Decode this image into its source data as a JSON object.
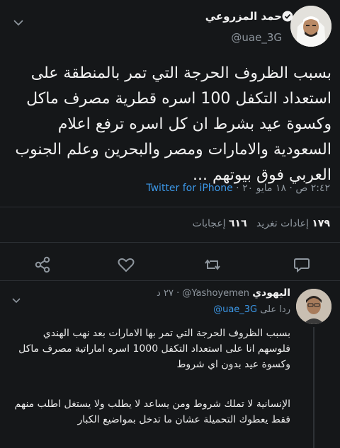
{
  "tweet": {
    "author_name": "حمد المزروعي",
    "handle": "@uae_3G",
    "text": "بسبب الظروف الحرجة التي تمر بالمنطقة على استعداد التكفل 100 اسره قطرية مصرف ماكل وكسوة عيد بشرط ان كل اسره ترفع اعلام السعودية والامارات ومصر والبحرين وعلم الجنوب العربي فوق بيوتهم ...",
    "time": "٢:٤٢ ص",
    "separator": "·",
    "date": "١٨ مايو ٢٠",
    "client": "Twitter for iPhone",
    "retweets_count": "١٧٩",
    "retweets_label": "إعادات تغريد",
    "likes_count": "٦١٦",
    "likes_label": "إعجابات"
  },
  "actions": [
    {
      "icon": "reply-icon"
    },
    {
      "icon": "retweet-icon"
    },
    {
      "icon": "like-icon"
    },
    {
      "icon": "share-icon"
    }
  ],
  "reply": {
    "author_name": "اليهودي",
    "handle": "@Yashoyemen",
    "separator": "·",
    "time_ago": "٢٧ د",
    "replying_to_label": "ردا على",
    "replying_to_handle": "@uae_3G",
    "paragraph_1": "بسبب الظروف الحرجة التي تمر بها الامارات بعد نهب الهندي فلوسهم انا على استعداد التكفل 1000 اسره اماراتية مصرف ماكل وكسوة عيد بدون اي شروط",
    "paragraph_2": "الإنسانية لا تملك شروط ومن يساعد لا يطلب ولا يستغل اطلب منهم فقط يعطوك التحميلة عشان ما تدخل بمواضيع الكبار"
  },
  "colors": {
    "background": "#151719",
    "accent": "#3c98e8",
    "secondary_text": "#8e969e"
  }
}
